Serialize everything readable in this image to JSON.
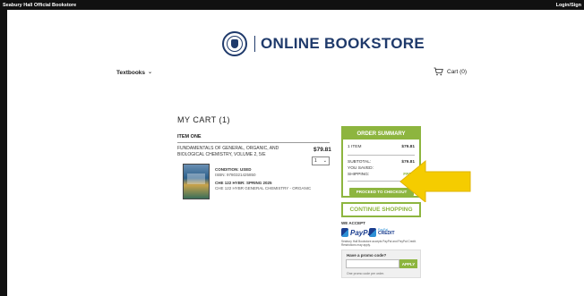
{
  "topbar": {
    "store_name": "Seabury Hall Official Bookstore",
    "login": "Login/Sign"
  },
  "header": {
    "logo_text": "ONLINE BOOKSTORE"
  },
  "nav": {
    "textbooks_label": "Textbooks",
    "cart_label": "Cart (0)"
  },
  "cart": {
    "title": "MY CART (1)",
    "item_header": "ITEM ONE",
    "item": {
      "title": "FUNDAMENTALS OF GENERAL, ORGANIC, AND BIOLOGICAL CHEMISTRY, VOLUME 2, 5/E",
      "price": "$79.81",
      "quantity": "1",
      "condition": "CONDITION: USED",
      "isbn": "ISBN: 9780321425850",
      "course_code": "CHE 122 HYBR: SPRING 2025",
      "course_name": "CHE 122 HYBR GENERAL CHEMISTRY - ORGANIC"
    }
  },
  "summary": {
    "heading": "ORDER SUMMARY",
    "items_label": "1 ITEM",
    "items_value": "$79.81",
    "subtotal_label": "SUBTOTAL:",
    "subtotal_value": "$79.81",
    "saved_label": "YOU SAVED:",
    "saved_value": "",
    "shipping_label": "SHIPPING:",
    "shipping_value": "FREE",
    "checkout_label": "PROCEED TO CHECKOUT"
  },
  "continue_label": "CONTINUE SHOPPING",
  "payments": {
    "we_accept": "WE ACCEPT",
    "paypal": "PayPal",
    "paypal_credit": "PayPal",
    "paypal_credit_sub": "CREDIT",
    "note": "Seabury Hall Bookstore accepts PayPal and PayPal Credit. Restrictions may apply."
  },
  "promo": {
    "label": "Have a promo code?",
    "placeholder": "",
    "apply_label": "APPLY",
    "note": "One promo code per order."
  },
  "colors": {
    "accent": "#8db53f",
    "brand": "#1f3a6b",
    "arrow": "#f5cc00"
  }
}
